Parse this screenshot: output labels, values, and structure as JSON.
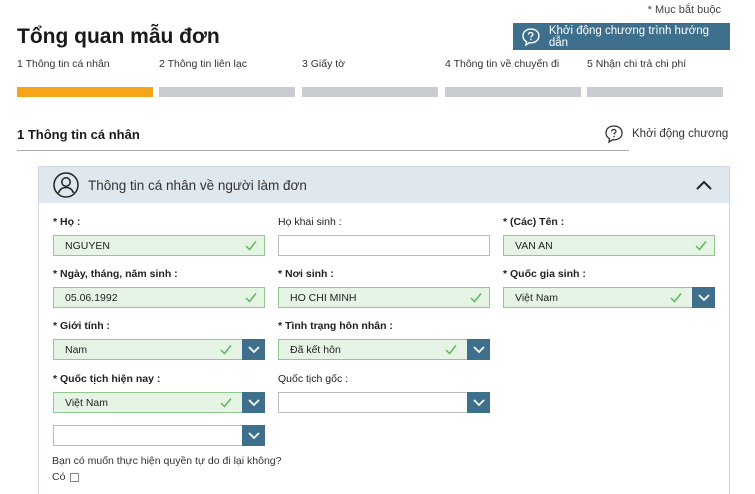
{
  "required_note": "* Mục bắt buộc",
  "page_title": "Tổng quan mẫu đơn",
  "guide_button": "Khởi động chương trình hướng dẫn",
  "steps": [
    {
      "label": "1 Thông tin cá nhân",
      "active": true
    },
    {
      "label": "2 Thông tin liên lạc",
      "active": false
    },
    {
      "label": "3 Giấy tờ",
      "active": false
    },
    {
      "label": "4 Thông tin về chuyến đi",
      "active": false
    },
    {
      "label": "5 Nhận chi trả chi phí",
      "active": false
    }
  ],
  "section_title": "1 Thông tin cá nhân",
  "side_guide": "Khởi động chương",
  "panel_title": "Thông tin cá nhân về người làm đơn",
  "fields": {
    "ho": {
      "label": "* Họ :",
      "value": "NGUYEN"
    },
    "ho_khai_sinh": {
      "label": "Họ khai sinh :",
      "value": ""
    },
    "ten": {
      "label": "* (Các) Tên :",
      "value": "VAN AN"
    },
    "ngay_sinh": {
      "label": "* Ngày, tháng, năm sinh :",
      "value": "05.06.1992"
    },
    "noi_sinh": {
      "label": "* Nơi sinh :",
      "value": "HO CHI MINH"
    },
    "quoc_gia_sinh": {
      "label": "* Quốc gia sinh :",
      "value": "Việt Nam"
    },
    "gioi_tinh": {
      "label": "* Giới tính :",
      "value": "Nam"
    },
    "hon_nhan": {
      "label": "* Tình trạng hôn nhân :",
      "value": "Đã kết hôn"
    },
    "quoc_tich": {
      "label": "* Quốc tịch hiện nay :",
      "value": "Việt Nam"
    },
    "quoc_tich_goc": {
      "label": "Quốc tịch gốc :",
      "value": ""
    },
    "extra_select": {
      "value": ""
    }
  },
  "question": "Bạn có muốn thực hiện quyền tự do đi lại không?",
  "checkbox_label": "Có",
  "colors": {
    "accent": "#3e6f8d",
    "progress": "#f6a519",
    "valid_bg": "#e6f4e6"
  }
}
